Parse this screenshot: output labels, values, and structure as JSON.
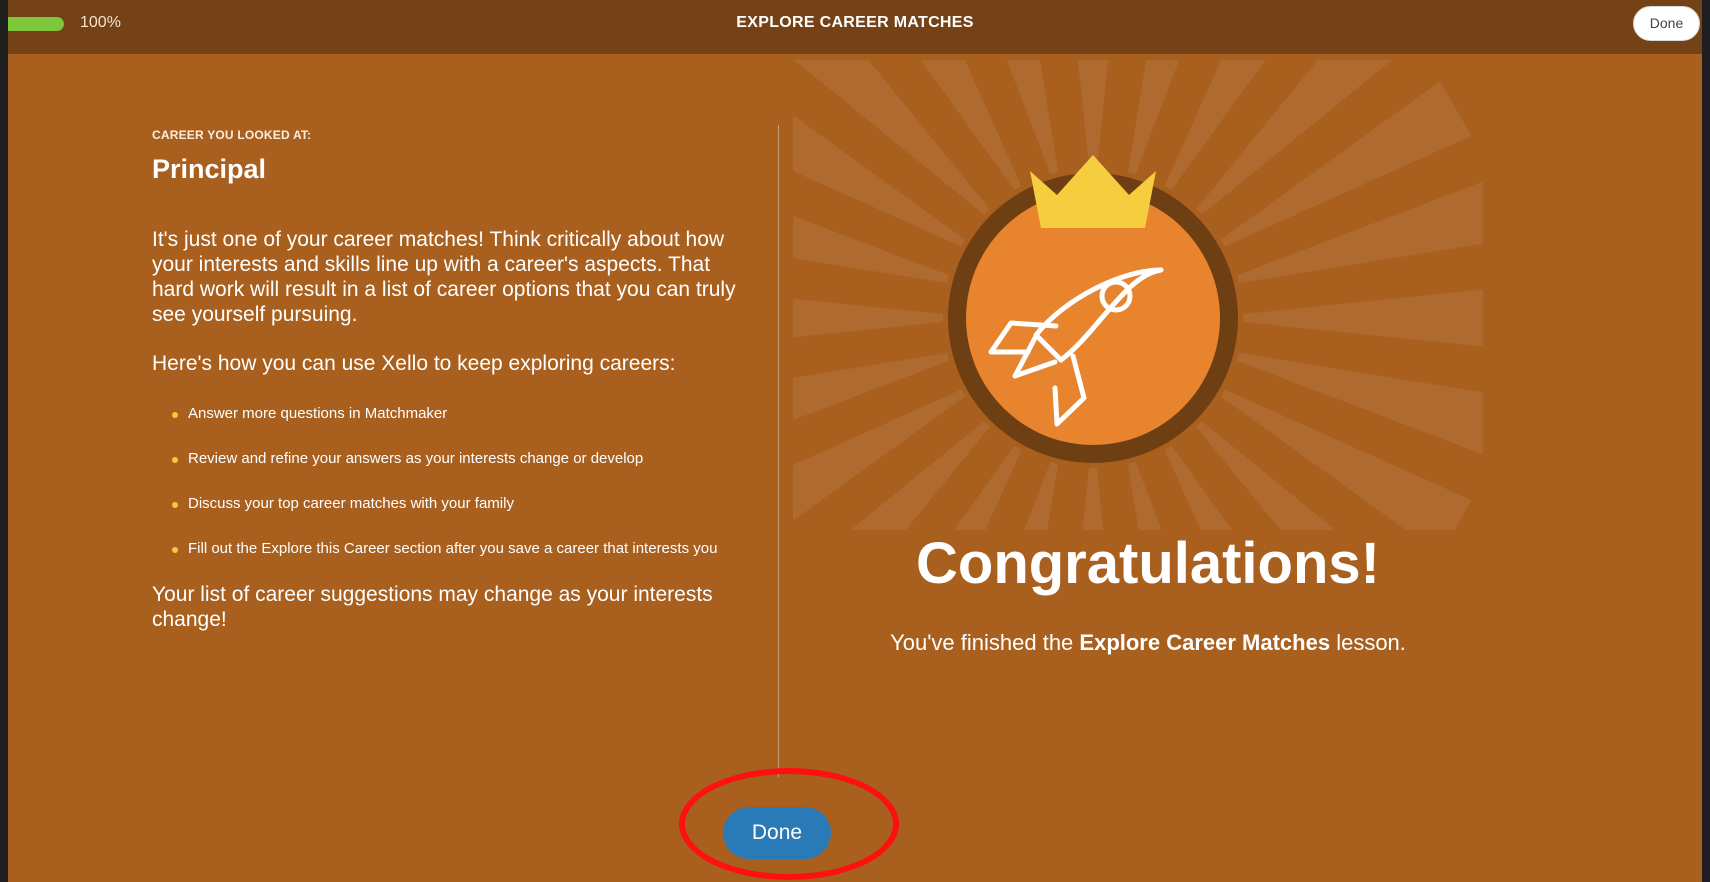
{
  "topbar": {
    "progress_value": 1.0,
    "progress_label": "100%",
    "title": "EXPLORE CAREER MATCHES",
    "done_label": "Done"
  },
  "left": {
    "eyebrow": "CAREER YOU LOOKED AT:",
    "career_title": "Principal",
    "intro": "It's just one of your career matches! Think critically about how your interests and skills line up with a career's aspects. That hard work will result in a list of career options that you can truly see yourself pursuing.",
    "use_intro": "Here's how you can use Xello to keep exploring careers:",
    "bullets": [
      "Answer more questions in Matchmaker",
      "Review and refine your answers as your interests change or develop",
      "Discuss your top career matches with your family",
      "Fill out the Explore this Career section after you save a career that interests you"
    ],
    "closing": "Your list of career suggestions may change as your interests change!"
  },
  "badge": {
    "icon": "rocket-icon",
    "crown_icon": "crown-icon"
  },
  "congrats": {
    "heading": "Congratulations!",
    "finished_prefix": "You've finished the ",
    "lesson_name": "Explore Career Matches",
    "finished_suffix": " lesson."
  },
  "footer": {
    "done_label": "Done"
  },
  "colors": {
    "background": "#a95f1e",
    "topbar": "#744216",
    "progress": "#7ec63a",
    "badge_fill": "#e8832e",
    "badge_ring": "#6f3f14",
    "crown": "#f7cd40",
    "done_button": "#2b7ab8",
    "annotation": "#ff1010"
  }
}
